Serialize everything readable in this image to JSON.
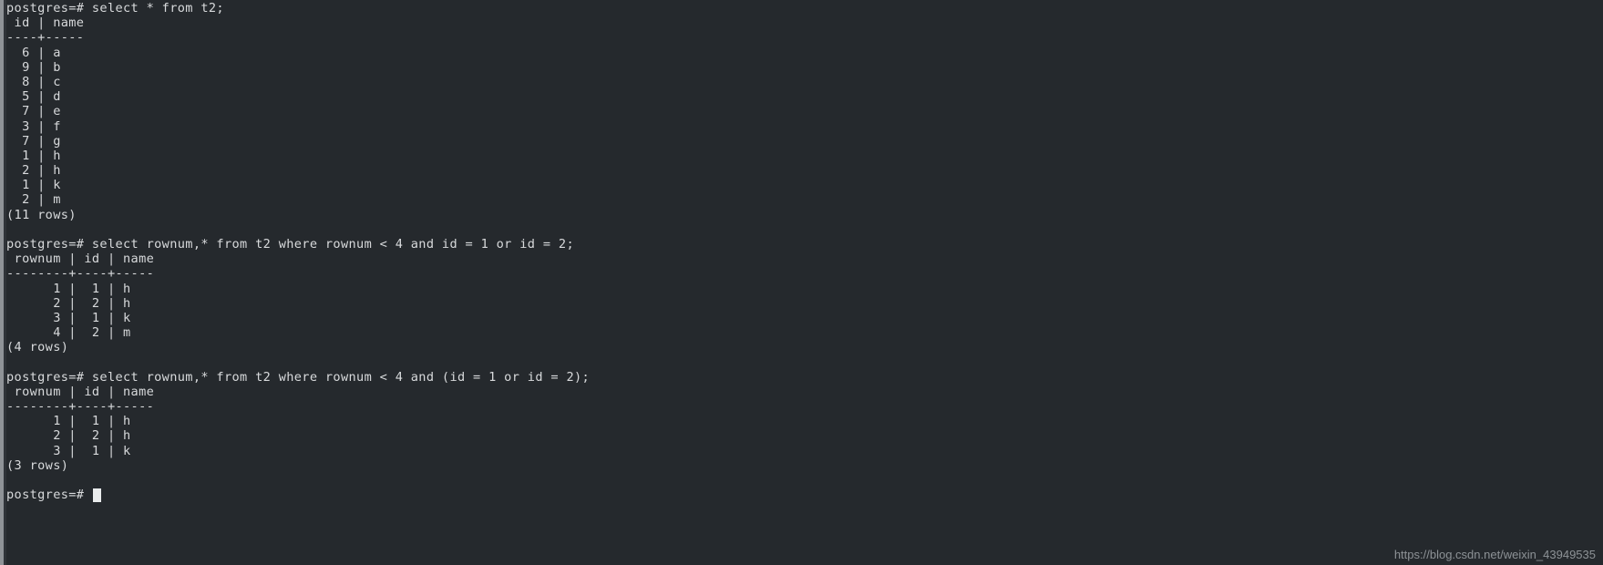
{
  "terminal": {
    "background_color": "#25292d",
    "text_color": "#d8dadc",
    "prompt": "postgres=#",
    "lines": [
      "postgres=# select * from t2;",
      " id | name",
      "----+-----",
      "  6 | a",
      "  9 | b",
      "  8 | c",
      "  5 | d",
      "  7 | e",
      "  3 | f",
      "  7 | g",
      "  1 | h",
      "  2 | h",
      "  1 | k",
      "  2 | m",
      "(11 rows)",
      "",
      "postgres=# select rownum,* from t2 where rownum < 4 and id = 1 or id = 2;",
      " rownum | id | name",
      "--------+----+-----",
      "      1 |  1 | h",
      "      2 |  2 | h",
      "      3 |  1 | k",
      "      4 |  2 | m",
      "(4 rows)",
      "",
      "postgres=# select rownum,* from t2 where rownum < 4 and (id = 1 or id = 2);",
      " rownum | id | name",
      "--------+----+-----",
      "      1 |  1 | h",
      "      2 |  2 | h",
      "      3 |  1 | k",
      "(3 rows)",
      ""
    ],
    "final_prompt": "postgres=# ",
    "cursor": "block"
  },
  "queries": [
    {
      "sql": "select * from t2;",
      "columns": [
        "id",
        "name"
      ],
      "rows": [
        [
          "6",
          "a"
        ],
        [
          "9",
          "b"
        ],
        [
          "8",
          "c"
        ],
        [
          "5",
          "d"
        ],
        [
          "7",
          "e"
        ],
        [
          "3",
          "f"
        ],
        [
          "7",
          "g"
        ],
        [
          "1",
          "h"
        ],
        [
          "2",
          "h"
        ],
        [
          "1",
          "k"
        ],
        [
          "2",
          "m"
        ]
      ],
      "row_count_label": "(11 rows)"
    },
    {
      "sql": "select rownum,* from t2 where rownum < 4 and id = 1 or id = 2;",
      "columns": [
        "rownum",
        "id",
        "name"
      ],
      "rows": [
        [
          "1",
          "1",
          "h"
        ],
        [
          "2",
          "2",
          "h"
        ],
        [
          "3",
          "1",
          "k"
        ],
        [
          "4",
          "2",
          "m"
        ]
      ],
      "row_count_label": "(4 rows)"
    },
    {
      "sql": "select rownum,* from t2 where rownum < 4 and (id = 1 or id = 2);",
      "columns": [
        "rownum",
        "id",
        "name"
      ],
      "rows": [
        [
          "1",
          "1",
          "h"
        ],
        [
          "2",
          "2",
          "h"
        ],
        [
          "3",
          "1",
          "k"
        ]
      ],
      "row_count_label": "(3 rows)"
    }
  ],
  "watermark": {
    "text": "https://blog.csdn.net/weixin_43949535",
    "color": "#8d9296"
  }
}
